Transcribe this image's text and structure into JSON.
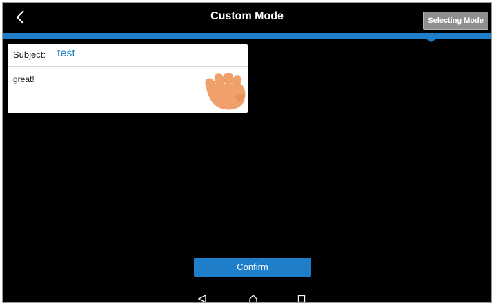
{
  "header": {
    "title": "Custom Mode",
    "mode_button": "Selecting Mode"
  },
  "card": {
    "subject_label": "Subject:",
    "subject_value": "test",
    "body": "great!"
  },
  "footer": {
    "confirm_label": "Confirm"
  },
  "icons": {
    "back": "chevron-left-icon",
    "pointer": "hand-pointer-icon",
    "nav_back": "triangle-back-icon",
    "nav_home": "home-icon",
    "nav_recent": "square-recent-icon"
  },
  "colors": {
    "accent": "#1e7ec9",
    "subject_value": "#2486c8",
    "background": "#000000",
    "hand": "#f0a06a"
  }
}
